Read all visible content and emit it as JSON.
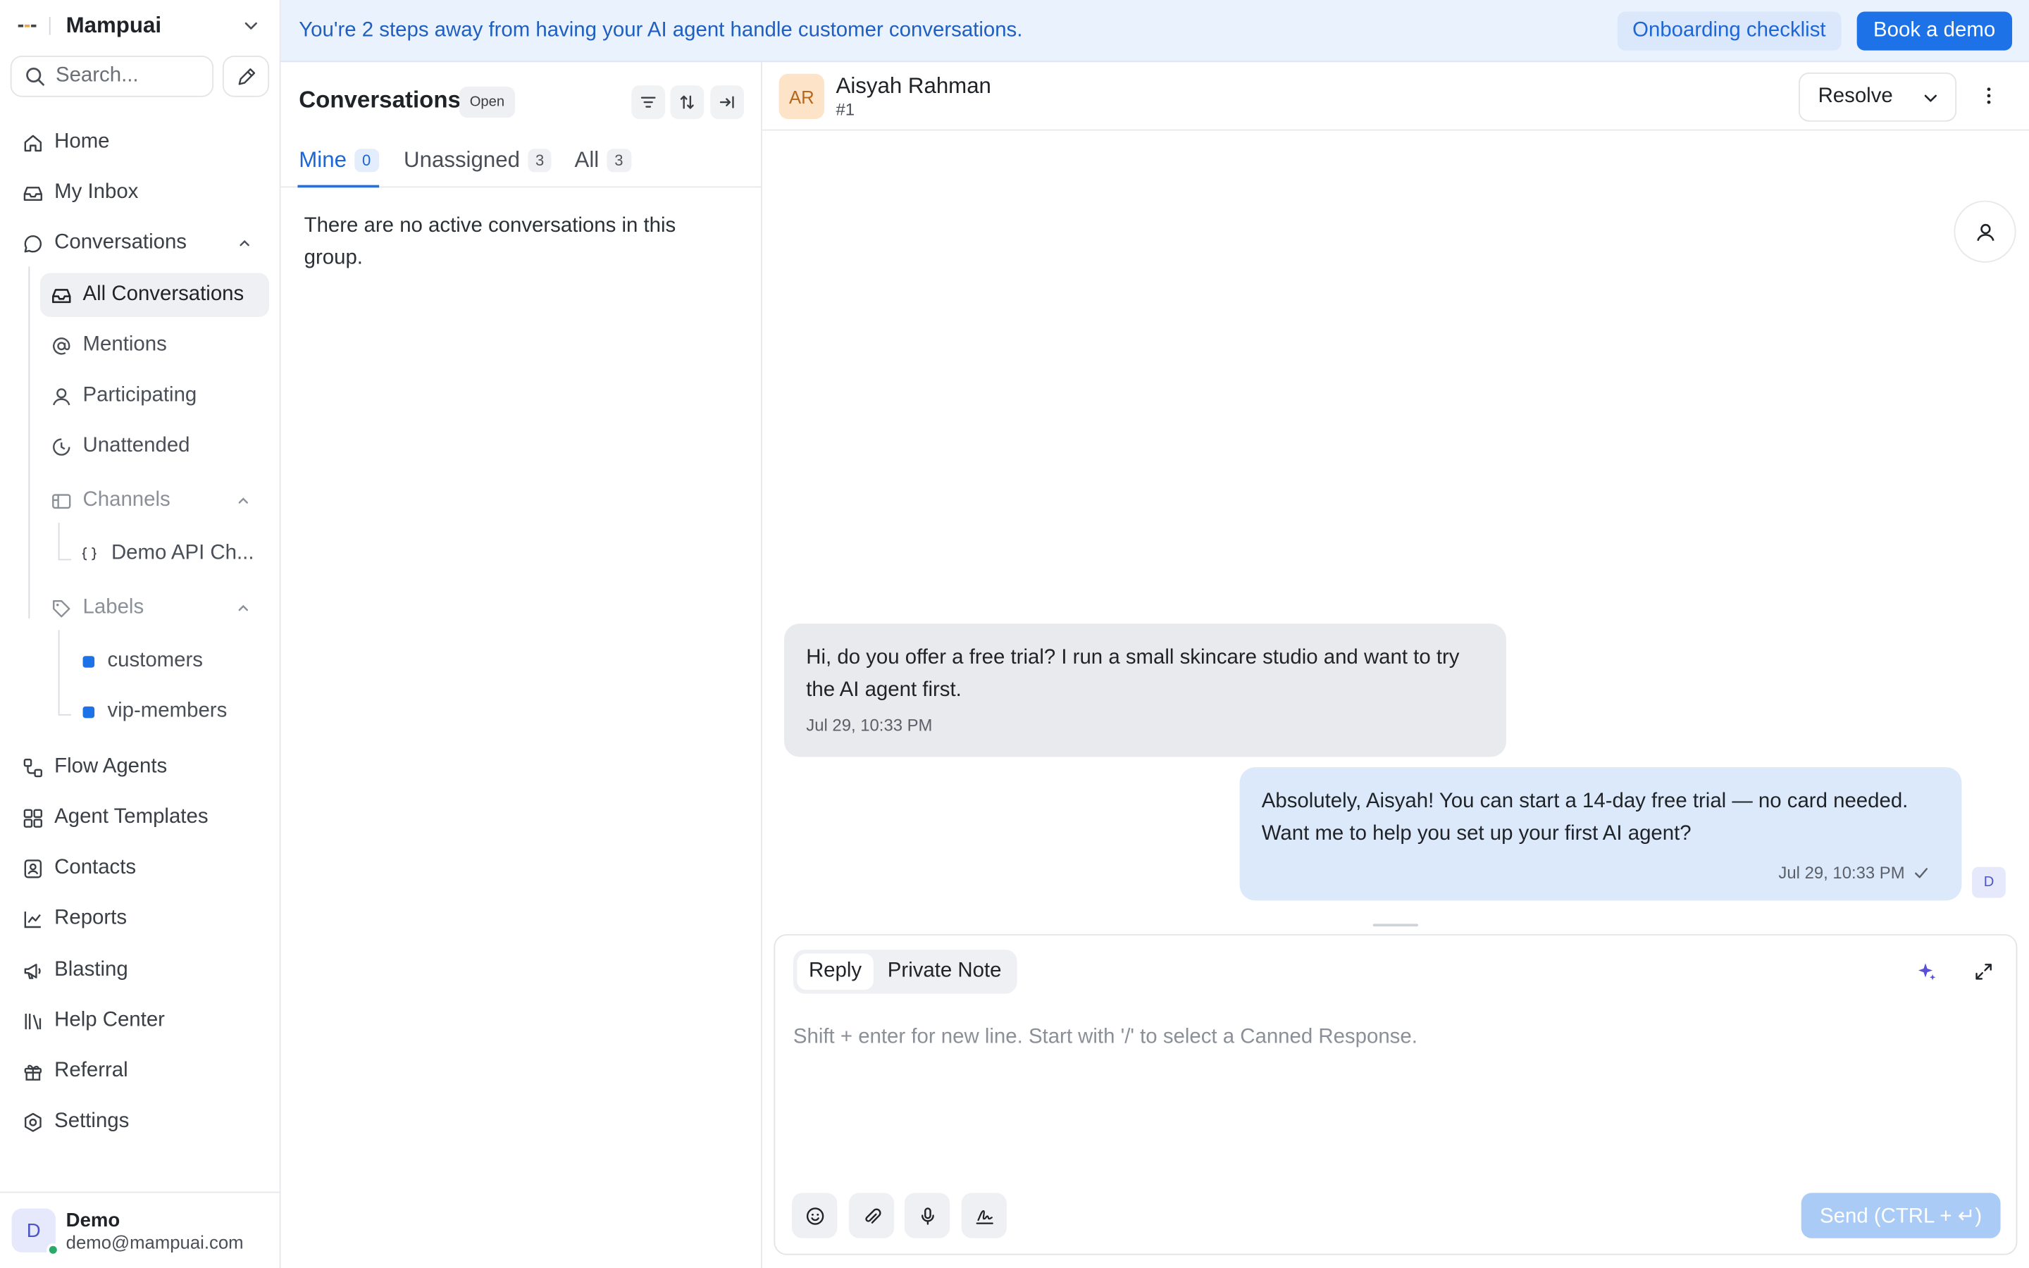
{
  "app": {
    "name": "Mampuai"
  },
  "search": {
    "placeholder": "Search..."
  },
  "nav": {
    "home": "Home",
    "inbox": "My Inbox",
    "conversations": "Conversations",
    "all_conversations": "All Conversations",
    "mentions": "Mentions",
    "participating": "Participating",
    "unattended": "Unattended",
    "channels": "Channels",
    "channel_item": "Demo API Ch...",
    "labels": "Labels",
    "label_items": [
      "customers",
      "vip-members"
    ],
    "flow_agents": "Flow Agents",
    "agent_templates": "Agent Templates",
    "contacts": "Contacts",
    "reports": "Reports",
    "blasting": "Blasting",
    "help_center": "Help Center",
    "referral": "Referral",
    "settings": "Settings"
  },
  "user": {
    "initial": "D",
    "name": "Demo",
    "email": "demo@mampuai.com"
  },
  "banner": {
    "text": "You're 2 steps away from having your AI agent handle customer conversations.",
    "onboarding": "Onboarding checklist",
    "demo": "Book a demo"
  },
  "list": {
    "title": "Conversations",
    "status": "Open",
    "tabs": [
      {
        "label": "Mine",
        "count": "0"
      },
      {
        "label": "Unassigned",
        "count": "3"
      },
      {
        "label": "All",
        "count": "3"
      }
    ],
    "empty": "There are no active conversations in this group."
  },
  "chat": {
    "contact_initials": "AR",
    "contact_name": "Aisyah Rahman",
    "contact_id": "#1",
    "resolve": "Resolve",
    "messages": [
      {
        "text": "Hi, do you offer a free trial? I run a small skincare studio and want to try the AI agent first.",
        "time": "Jul 29, 10:33 PM"
      },
      {
        "text": "Absolutely, Aisyah! You can start a 14-day free trial — no card needed. Want me to help you set up your first AI agent?",
        "time": "Jul 29, 10:33 PM",
        "agent": "D"
      }
    ]
  },
  "composer": {
    "reply": "Reply",
    "private_note": "Private Note",
    "placeholder": "Shift + enter for new line. Start with '/' to select a Canned Response.",
    "send": "Send (CTRL + ↵)"
  },
  "colors": {
    "accent": "#1d72e8",
    "banner_bg": "#eaf2fd",
    "incoming_bubble": "#e9eaee",
    "outgoing_bubble": "#dbe9fb"
  },
  "icons": [
    "home-icon",
    "inbox-icon",
    "chat-icon",
    "at-icon",
    "person-icon",
    "clock-icon",
    "channels-icon",
    "braces-icon",
    "tag-icon",
    "flow-icon",
    "grid-icon",
    "contacts-icon",
    "chart-icon",
    "megaphone-icon",
    "library-icon",
    "gift-icon",
    "gear-icon",
    "filter-icon",
    "sort-icon",
    "collapse-icon",
    "kebab-icon",
    "sparkle-icon",
    "expand-icon",
    "emoji-icon",
    "paperclip-icon",
    "mic-icon",
    "signature-icon",
    "check-icon"
  ]
}
